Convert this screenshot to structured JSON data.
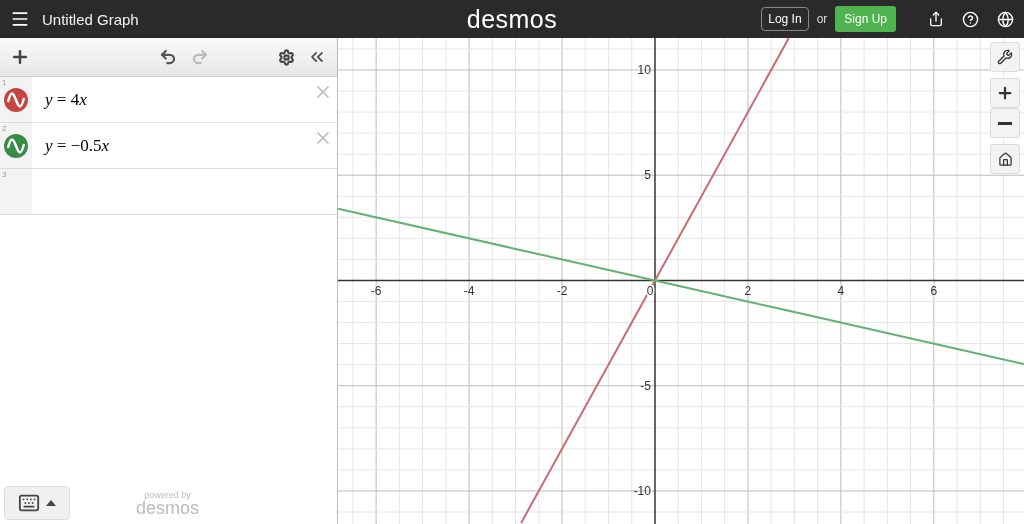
{
  "header": {
    "title": "Untitled Graph",
    "logo": "desmos",
    "login": "Log In",
    "or": "or",
    "signup": "Sign Up"
  },
  "expressions": [
    {
      "index": "1",
      "latex": "y = 4x",
      "color": "#c74440"
    },
    {
      "index": "2",
      "latex": "y = −0.5x",
      "color": "#388c46"
    },
    {
      "index": "3"
    }
  ],
  "footer": {
    "powered_by": "powered by",
    "logo": "desmos"
  },
  "graph": {
    "chart_data": {
      "type": "line",
      "grid": true,
      "x": [
        -6.82,
        -2.88,
        0,
        2.88,
        7.94
      ],
      "xlim": [
        -6.82,
        7.94
      ],
      "ylim": [
        -11.57,
        11.52
      ],
      "series": [
        {
          "color": "#c86d72",
          "values": [
            null,
            -11.52,
            0,
            11.52,
            null
          ]
        },
        {
          "color": "#5fb36e",
          "values": [
            3.41,
            1.44,
            0,
            -1.44,
            -3.97
          ]
        }
      ],
      "xticks": [
        -6,
        -4,
        -2,
        0,
        2,
        4,
        6
      ],
      "yticks": [
        -10,
        -5,
        5,
        10
      ]
    }
  }
}
